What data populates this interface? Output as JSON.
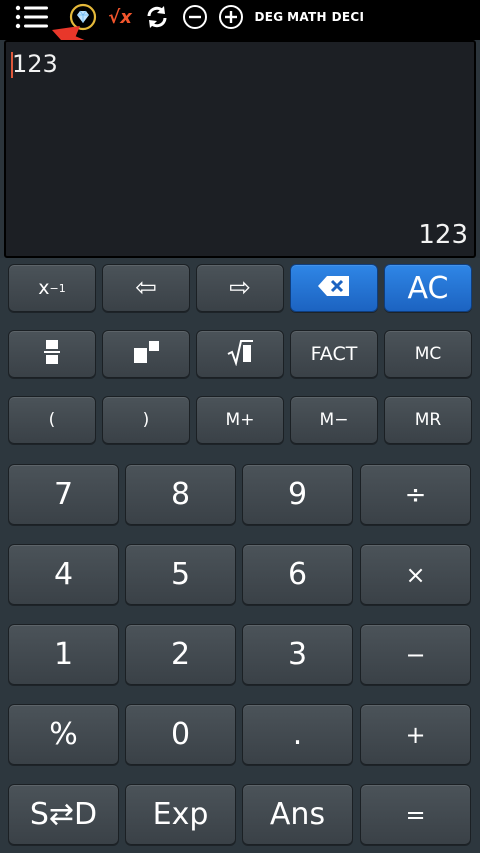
{
  "toolbar": {
    "icons": [
      "menu-icon",
      "gem-icon",
      "sqrt-x-icon",
      "refresh-icon",
      "minus-circle-icon",
      "plus-circle-icon"
    ],
    "sqrt_label": "√x",
    "deg_label": "DEG",
    "math_label": "MATH",
    "deci_label": "DECI"
  },
  "display": {
    "expression": "123",
    "result": "123"
  },
  "keys": {
    "inverse_base": "x",
    "inverse_exp": "−1",
    "left_arrow": "⇦",
    "right_arrow": "⇨",
    "fact": "FACT",
    "mc": "MC",
    "paren_open": "(",
    "paren_close": ")",
    "m_plus": "M+",
    "m_minus": "M−",
    "mr": "MR",
    "ac": "AC",
    "d7": "7",
    "d8": "8",
    "d9": "9",
    "divide": "÷",
    "d4": "4",
    "d5": "5",
    "d6": "6",
    "multiply": "×",
    "d1": "1",
    "d2": "2",
    "d3": "3",
    "minus": "−",
    "percent": "%",
    "d0": "0",
    "dot": ".",
    "plus": "+",
    "sd": "S⇄D",
    "exp": "Exp",
    "ans": "Ans",
    "equals": "="
  },
  "colors": {
    "accent_blue": "#2f86e6",
    "cursor": "#e0583b",
    "arrow": "#e8372a",
    "gem_ring": "#e5b93a"
  }
}
